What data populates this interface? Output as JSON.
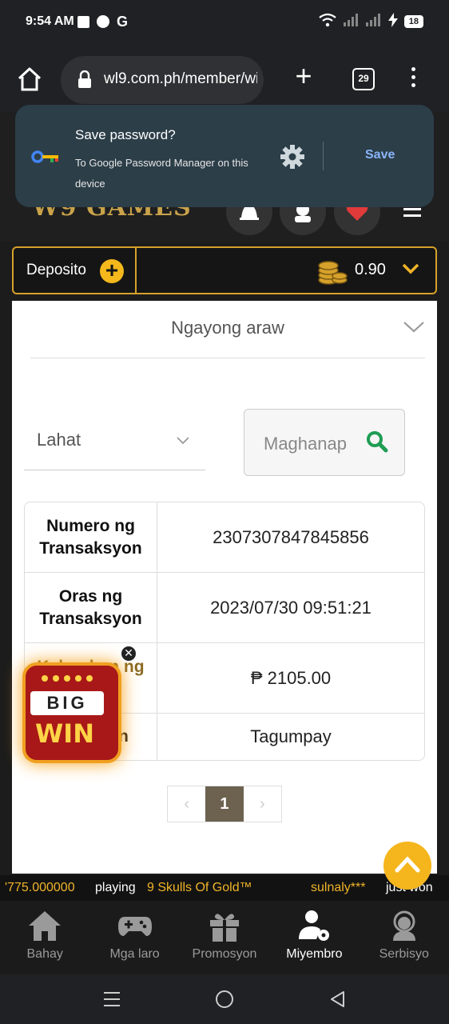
{
  "status": {
    "time": "9:54 AM",
    "g": "G",
    "battery": "18"
  },
  "browser": {
    "url": "wl9.com.ph/member/wi",
    "tab_count": "29"
  },
  "password_prompt": {
    "title": "Save password?",
    "subtitle": "To Google Password Manager on this device",
    "save_label": "Save"
  },
  "site": {
    "logo": "W9 GAMES"
  },
  "deposit": {
    "label": "Deposito",
    "balance": "0.90"
  },
  "filters": {
    "date_range": "Ngayong araw",
    "type": "Lahat",
    "search_label": "Maghanap"
  },
  "transaction": {
    "rows": [
      {
        "label": "Numero ng Transaksyon",
        "value": "2307307847845856"
      },
      {
        "label": "Oras ng Transaksyon",
        "value": "2023/07/30 09:51:21"
      },
      {
        "label": "Kabuuhan ng Halaga",
        "value": "₱ 2105.00"
      },
      {
        "label": "Katayuan",
        "value": "Tagumpay"
      }
    ]
  },
  "pagination": {
    "prev": "‹",
    "current": "1",
    "next": "›"
  },
  "promo": {
    "big": "BIG",
    "win": "WIN",
    "close": "✕"
  },
  "ticker": {
    "amount": "'775.000000",
    "playing": "playing",
    "game": "9 Skulls Of Gold™",
    "user": "sulnaly***",
    "just_won": "just won"
  },
  "nav": [
    {
      "label": "Bahay"
    },
    {
      "label": "Mga laro"
    },
    {
      "label": "Promosyon"
    },
    {
      "label": "Miyembro"
    },
    {
      "label": "Serbisyo"
    }
  ],
  "colors": {
    "accent": "#d6a12b",
    "dialog": "#2c3e48",
    "pager_active": "#6d6250",
    "search_icon": "#1f9d55"
  }
}
